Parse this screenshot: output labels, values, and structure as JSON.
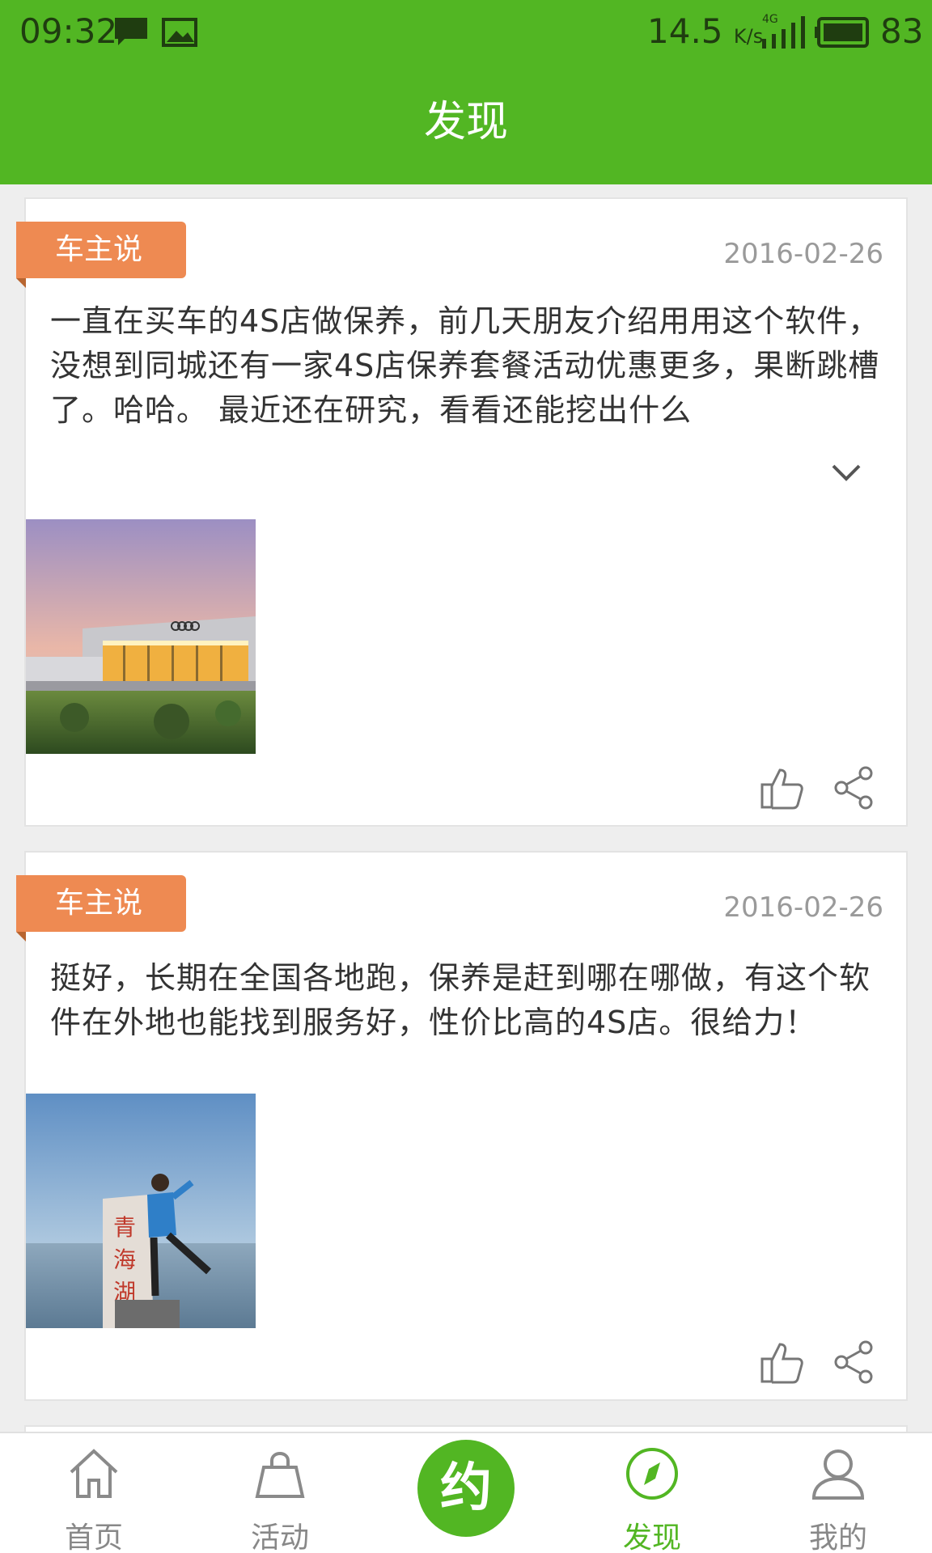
{
  "status_bar": {
    "time": "09:32",
    "speed_value": "14.5",
    "speed_unit": "K/s",
    "network": "4G",
    "battery_level": "83"
  },
  "header": {
    "title": "发现"
  },
  "posts": [
    {
      "tag": "车主说",
      "date": "2016-02-26",
      "text": "一直在买车的4S店做保养，前几天朋友介绍用用这个软件，没想到同城还有一家4S店保养套餐活动优惠更多，果断跳槽了。哈哈。 最近还在研究，看看还能挖出什么",
      "photo": "audi-dealership-photo"
    },
    {
      "tag": "车主说",
      "date": "2016-02-26",
      "text": "挺好，长期在全国各地跑，保养是赶到哪在哪做，有这个软件在外地也能找到服务好，性价比高的4S店。很给力！",
      "photo": "qinghai-lake-photo",
      "photo_sign_text": "青海湖"
    }
  ],
  "bottom_nav": {
    "home": "首页",
    "activity": "活动",
    "center": "约",
    "discover": "发现",
    "mine": "我的"
  },
  "colors": {
    "brand_green": "#52b623",
    "tag_orange": "#ee8a52",
    "date_gray": "#9a9a9a"
  }
}
